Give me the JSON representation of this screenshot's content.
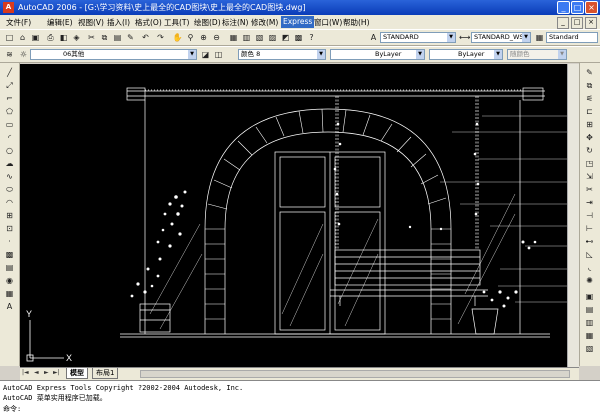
{
  "window": {
    "title": "AutoCAD 2006 - [G:\\学习资料\\史上最全的CAD图块\\史上最全的CAD图块.dwg]",
    "app_icon": "autocad-logo-icon",
    "controls": [
      "_",
      "□",
      "×"
    ]
  },
  "menu": {
    "items": [
      "文件(F)",
      "编辑(E)",
      "视图(V)",
      "插入(I)",
      "格式(O)",
      "工具(T)",
      "绘图(D)",
      "标注(N)",
      "修改(M)",
      "Express",
      "窗口(W)",
      "帮助(H)"
    ],
    "active": "Express",
    "doc_controls": [
      "_",
      "□",
      "×"
    ]
  },
  "toolbar_styles": {
    "text_style": "STANDARD",
    "dim_style": "STANDARD_WS",
    "table_style": "Standard"
  },
  "toolbar_layers": {
    "layer": "06其他",
    "color": "颜色 8",
    "linetype": "ByLayer",
    "lineweight": "ByLayer",
    "plotstyle": "随颜色"
  },
  "ucs": {
    "x_label": "X",
    "y_label": "Y"
  },
  "tabs": {
    "nav": [
      "|◄",
      "◄",
      "►",
      "►|"
    ],
    "items": [
      "模型",
      "布局1"
    ],
    "active": "模型"
  },
  "command": {
    "lines": [
      "AutoCAD Express Tools Copyright ?2002-2004 Autodesk, Inc.",
      "AutoCAD 菜单实用程序已加载。"
    ],
    "prompt": "命令:"
  },
  "colors": {
    "titlebar": "#0a3cb8",
    "canvas": "#000000",
    "drawing_lines": "#ffffff",
    "menu_bg": "#ece9d8"
  }
}
